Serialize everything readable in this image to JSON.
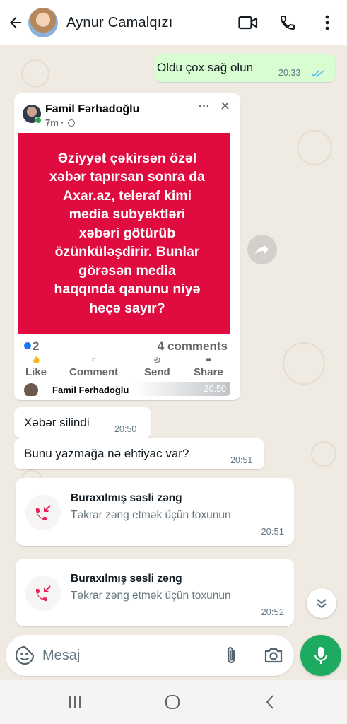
{
  "header": {
    "contact_name": "Aynur Camalqızı",
    "icons": [
      "back-arrow-icon",
      "video-call-icon",
      "voice-call-icon",
      "more-vert-icon"
    ]
  },
  "messages": {
    "out1": {
      "text": "Oldu çox sağ olun",
      "time": "20:33",
      "status": "read"
    },
    "shared_post": {
      "author": "Famil Fərhadoğlu",
      "age": "7m ·",
      "dots": "···",
      "close": "✕",
      "text": "Əziyyət çəkirsən özəl\nxəbər tapırsan sonra da\nAxar.az, teleraf kimi\nmedia subyektləri\nxəbəri götürüb\nözünküləşdirir. Bunlar\ngörəsən media\nhaqqında qanunu niyə\nheçə sayır?",
      "reactions": "2",
      "comments": "4 comments",
      "actions": {
        "like": "Like",
        "comment": "Comment",
        "send": "Send",
        "share": "Share"
      },
      "footer_name": "Famil Fərhadoğlu",
      "time": "20:50"
    },
    "in1": {
      "text": "Xəbər silindi",
      "time": "20:50"
    },
    "in2": {
      "text": "Bunu yazmağa nə ehtiyac var?",
      "time": "20:51"
    },
    "call1": {
      "title": "Buraxılmış səsli zəng",
      "subtitle": "Təkrar zəng etmək üçün toxunun",
      "time": "20:51"
    },
    "call2": {
      "title": "Buraxılmış səsli zəng",
      "subtitle": "Təkrar zəng etmək üçün toxunun",
      "time": "20:52"
    }
  },
  "composer": {
    "placeholder": "Mesaj"
  },
  "colors": {
    "accent_green": "#1daa61",
    "outgoing_bubble": "#d9fdd3",
    "missed_call_red": "#e0245e",
    "post_background": "#e00c40",
    "read_ticks": "#53bdeb"
  }
}
